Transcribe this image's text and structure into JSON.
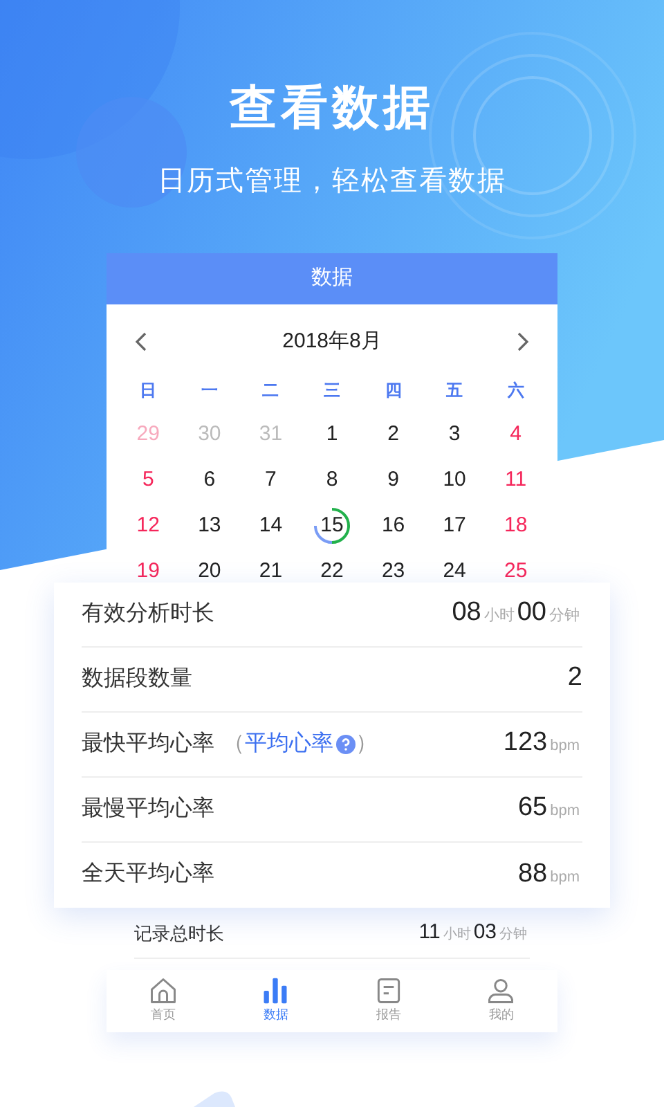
{
  "headline": "查看数据",
  "subtitle": "日历式管理，轻松查看数据",
  "screen": {
    "title": "数据",
    "calendar": {
      "month": "2018年8月",
      "weekdays": [
        "日",
        "一",
        "二",
        "三",
        "四",
        "五",
        "六"
      ],
      "weeks": [
        [
          {
            "text": "29",
            "in_month": false,
            "weekend": true,
            "selected": false
          },
          {
            "text": "30",
            "in_month": false,
            "weekend": false,
            "selected": false
          },
          {
            "text": "31",
            "in_month": false,
            "weekend": false,
            "selected": false
          },
          {
            "text": "1",
            "in_month": true,
            "weekend": false,
            "selected": false
          },
          {
            "text": "2",
            "in_month": true,
            "weekend": false,
            "selected": false
          },
          {
            "text": "3",
            "in_month": true,
            "weekend": false,
            "selected": false
          },
          {
            "text": "4",
            "in_month": true,
            "weekend": true,
            "selected": false
          }
        ],
        [
          {
            "text": "5",
            "in_month": true,
            "weekend": true,
            "selected": false
          },
          {
            "text": "6",
            "in_month": true,
            "weekend": false,
            "selected": false
          },
          {
            "text": "7",
            "in_month": true,
            "weekend": false,
            "selected": false
          },
          {
            "text": "8",
            "in_month": true,
            "weekend": false,
            "selected": false
          },
          {
            "text": "9",
            "in_month": true,
            "weekend": false,
            "selected": false
          },
          {
            "text": "10",
            "in_month": true,
            "weekend": false,
            "selected": false
          },
          {
            "text": "11",
            "in_month": true,
            "weekend": true,
            "selected": false
          }
        ],
        [
          {
            "text": "12",
            "in_month": true,
            "weekend": true,
            "selected": false
          },
          {
            "text": "13",
            "in_month": true,
            "weekend": false,
            "selected": false
          },
          {
            "text": "14",
            "in_month": true,
            "weekend": false,
            "selected": false
          },
          {
            "text": "15",
            "in_month": true,
            "weekend": false,
            "selected": true
          },
          {
            "text": "16",
            "in_month": true,
            "weekend": false,
            "selected": false
          },
          {
            "text": "17",
            "in_month": true,
            "weekend": false,
            "selected": false
          },
          {
            "text": "18",
            "in_month": true,
            "weekend": true,
            "selected": false
          }
        ],
        [
          {
            "text": "19",
            "in_month": true,
            "weekend": true,
            "selected": false
          },
          {
            "text": "20",
            "in_month": true,
            "weekend": false,
            "selected": false
          },
          {
            "text": "21",
            "in_month": true,
            "weekend": false,
            "selected": false
          },
          {
            "text": "22",
            "in_month": true,
            "weekend": false,
            "selected": false
          },
          {
            "text": "23",
            "in_month": true,
            "weekend": false,
            "selected": false
          },
          {
            "text": "24",
            "in_month": true,
            "weekend": false,
            "selected": false
          },
          {
            "text": "25",
            "in_month": true,
            "weekend": true,
            "selected": false
          }
        ]
      ]
    },
    "stats": [
      {
        "label": "有效分析时长",
        "value": [
          {
            "kind": "number",
            "text": "08"
          },
          {
            "kind": "unit",
            "text": "小时"
          },
          {
            "kind": "number",
            "text": "00"
          },
          {
            "kind": "unit",
            "text": "分钟"
          }
        ]
      },
      {
        "label": "数据段数量",
        "value": [
          {
            "kind": "number",
            "text": "2"
          }
        ]
      },
      {
        "label": "最快平均心率",
        "link": {
          "open": "（",
          "text": "平均心率",
          "close": "）"
        },
        "value": [
          {
            "kind": "number",
            "text": "123"
          },
          {
            "kind": "unit",
            "text": "bpm"
          }
        ]
      },
      {
        "label": "最慢平均心率",
        "value": [
          {
            "kind": "number",
            "text": "65"
          },
          {
            "kind": "unit",
            "text": "bpm"
          }
        ]
      },
      {
        "label": "全天平均心率",
        "value": [
          {
            "kind": "number",
            "text": "88"
          },
          {
            "kind": "unit",
            "text": "bpm"
          }
        ]
      }
    ],
    "record": {
      "label": "记录总时长",
      "value": [
        {
          "kind": "number",
          "text": "11"
        },
        {
          "kind": "unit",
          "text": "小时"
        },
        {
          "kind": "number",
          "text": "03"
        },
        {
          "kind": "unit",
          "text": "分钟"
        }
      ]
    },
    "tabs": [
      {
        "label": "首页",
        "selected": false
      },
      {
        "label": "数据",
        "selected": true
      },
      {
        "label": "报告",
        "selected": false
      },
      {
        "label": "我的",
        "selected": false
      }
    ]
  }
}
